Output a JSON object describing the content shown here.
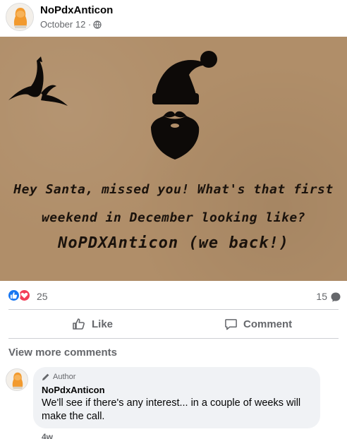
{
  "post": {
    "author": "NoPdxAnticon",
    "date": "October 12 ·",
    "privacy_icon": "globe-icon"
  },
  "image_card": {
    "line1": "Hey Santa, missed you! What's that first",
    "line2": "weekend in December looking like?",
    "line3": "NoPDXAnticon (we back!)",
    "background_color": "#b08e69",
    "ink_color": "#000000"
  },
  "reactions": {
    "count": "25",
    "types": [
      "like",
      "love"
    ],
    "comments_count": "15"
  },
  "actions": {
    "like_label": "Like",
    "comment_label": "Comment"
  },
  "view_more_label": "View more comments",
  "comment": {
    "badge": "Author",
    "author": "NoPdxAnticon",
    "text": "We'll see if there's any interest... in a couple of weeks will make the call.",
    "time": "4w"
  },
  "colors": {
    "accent_blue": "#1877f2",
    "love_red": "#f33e58",
    "secondary_text": "#65676b",
    "comment_bg": "#f0f2f5"
  }
}
